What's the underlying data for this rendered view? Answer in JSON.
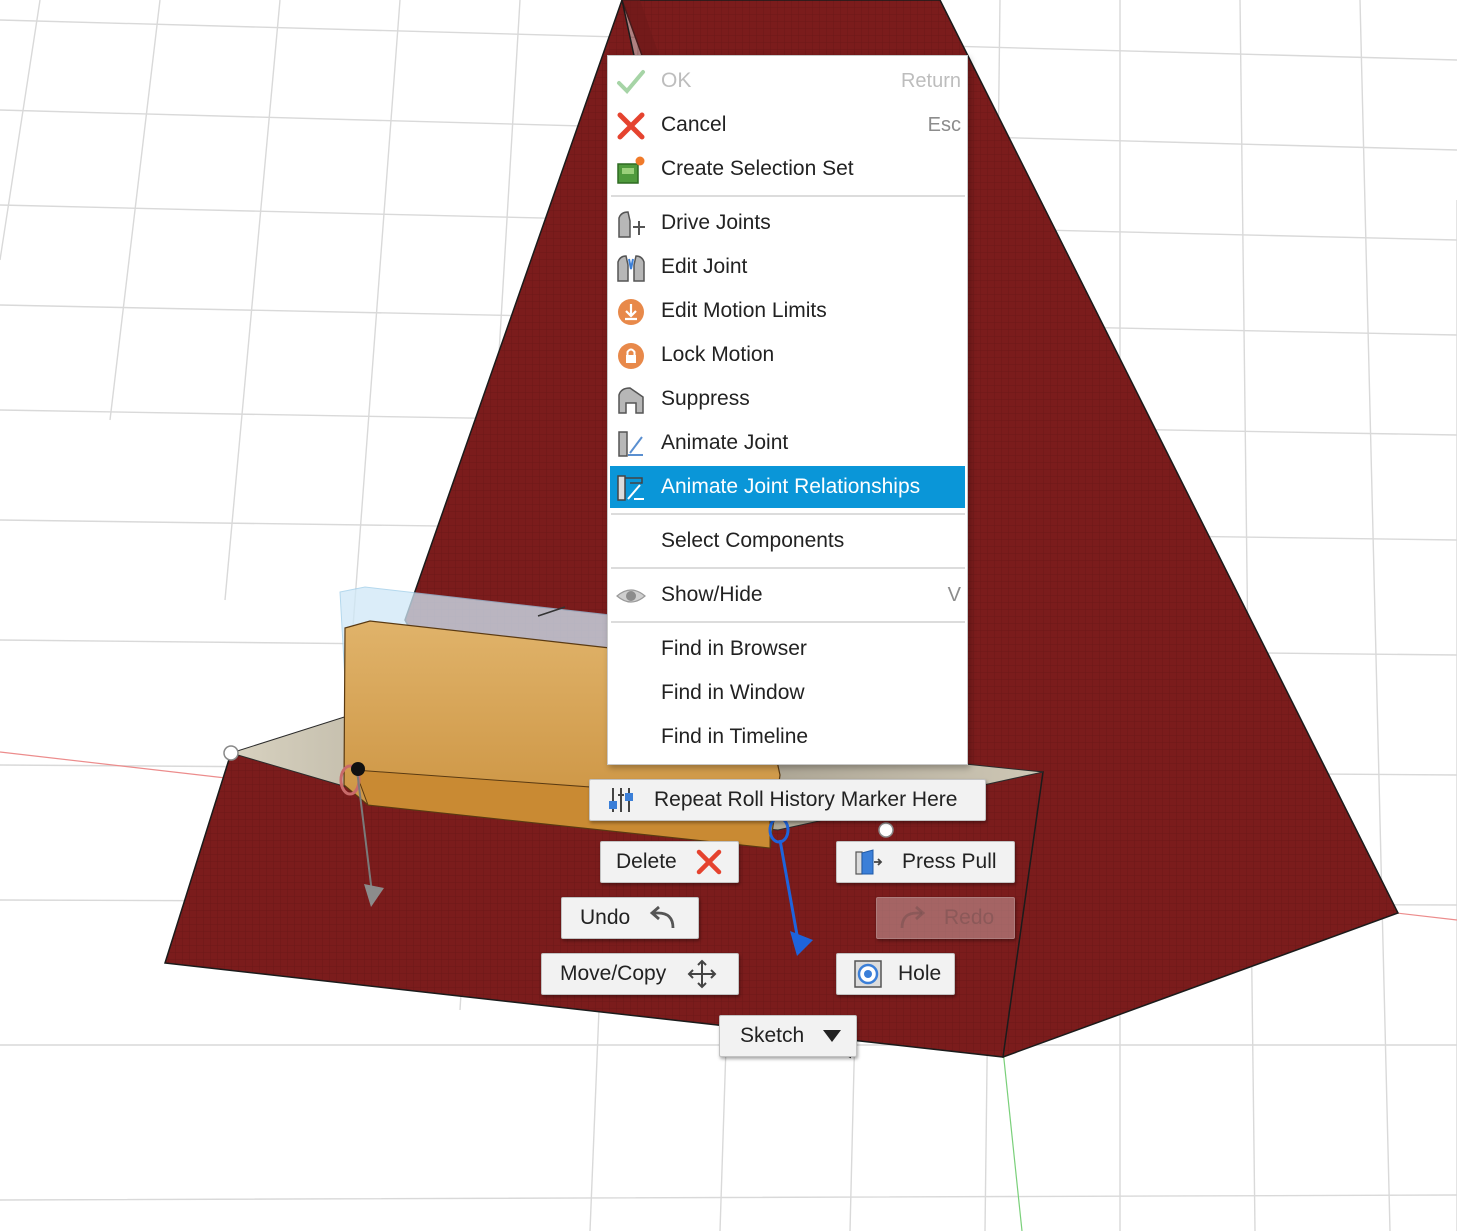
{
  "context_menu": {
    "items": [
      {
        "label": "OK",
        "shortcut": "Return",
        "icon": "checkmark-icon",
        "disabled": true
      },
      {
        "label": "Cancel",
        "shortcut": "Esc",
        "icon": "cancel-x-icon"
      },
      {
        "label": "Create Selection Set",
        "icon": "selection-set-icon"
      },
      {
        "label": "Drive Joints",
        "icon": "drive-joints-icon"
      },
      {
        "label": "Edit Joint",
        "icon": "edit-joint-icon"
      },
      {
        "label": "Edit Motion Limits",
        "icon": "motion-limits-icon"
      },
      {
        "label": "Lock Motion",
        "icon": "lock-icon"
      },
      {
        "label": "Suppress",
        "icon": "suppress-icon"
      },
      {
        "label": "Animate Joint",
        "icon": "animate-joint-icon"
      },
      {
        "label": "Animate Joint Relationships",
        "icon": "animate-joint-relationships-icon",
        "highlighted": true
      },
      {
        "label": "Select Components"
      },
      {
        "label": "Show/Hide",
        "shortcut": "V",
        "icon": "eye-icon"
      },
      {
        "label": "Find in Browser"
      },
      {
        "label": "Find in Window"
      },
      {
        "label": "Find in Timeline"
      }
    ]
  },
  "marking_menu": {
    "repeat": {
      "label": "Repeat Roll History Marker Here",
      "icon": "roll-history-icon"
    },
    "delete": {
      "label": "Delete",
      "icon": "delete-x-icon"
    },
    "press_pull": {
      "label": "Press Pull",
      "icon": "press-pull-icon"
    },
    "undo": {
      "label": "Undo",
      "icon": "undo-arrow-icon"
    },
    "redo": {
      "label": "Redo",
      "icon": "redo-arrow-icon",
      "disabled": true
    },
    "move_copy": {
      "label": "Move/Copy",
      "icon": "move-arrows-icon"
    },
    "hole": {
      "label": "Hole",
      "icon": "hole-icon"
    },
    "sketch": {
      "label": "Sketch",
      "icon": "dropdown-triangle-icon"
    }
  },
  "colors": {
    "pyramid_face": "#7b1c1c",
    "pyramid_face_dark": "#6a1717",
    "selection_blue": "#0a96d8",
    "panel_tan": "#d9a24e",
    "axis_blue": "#1e64dc"
  }
}
